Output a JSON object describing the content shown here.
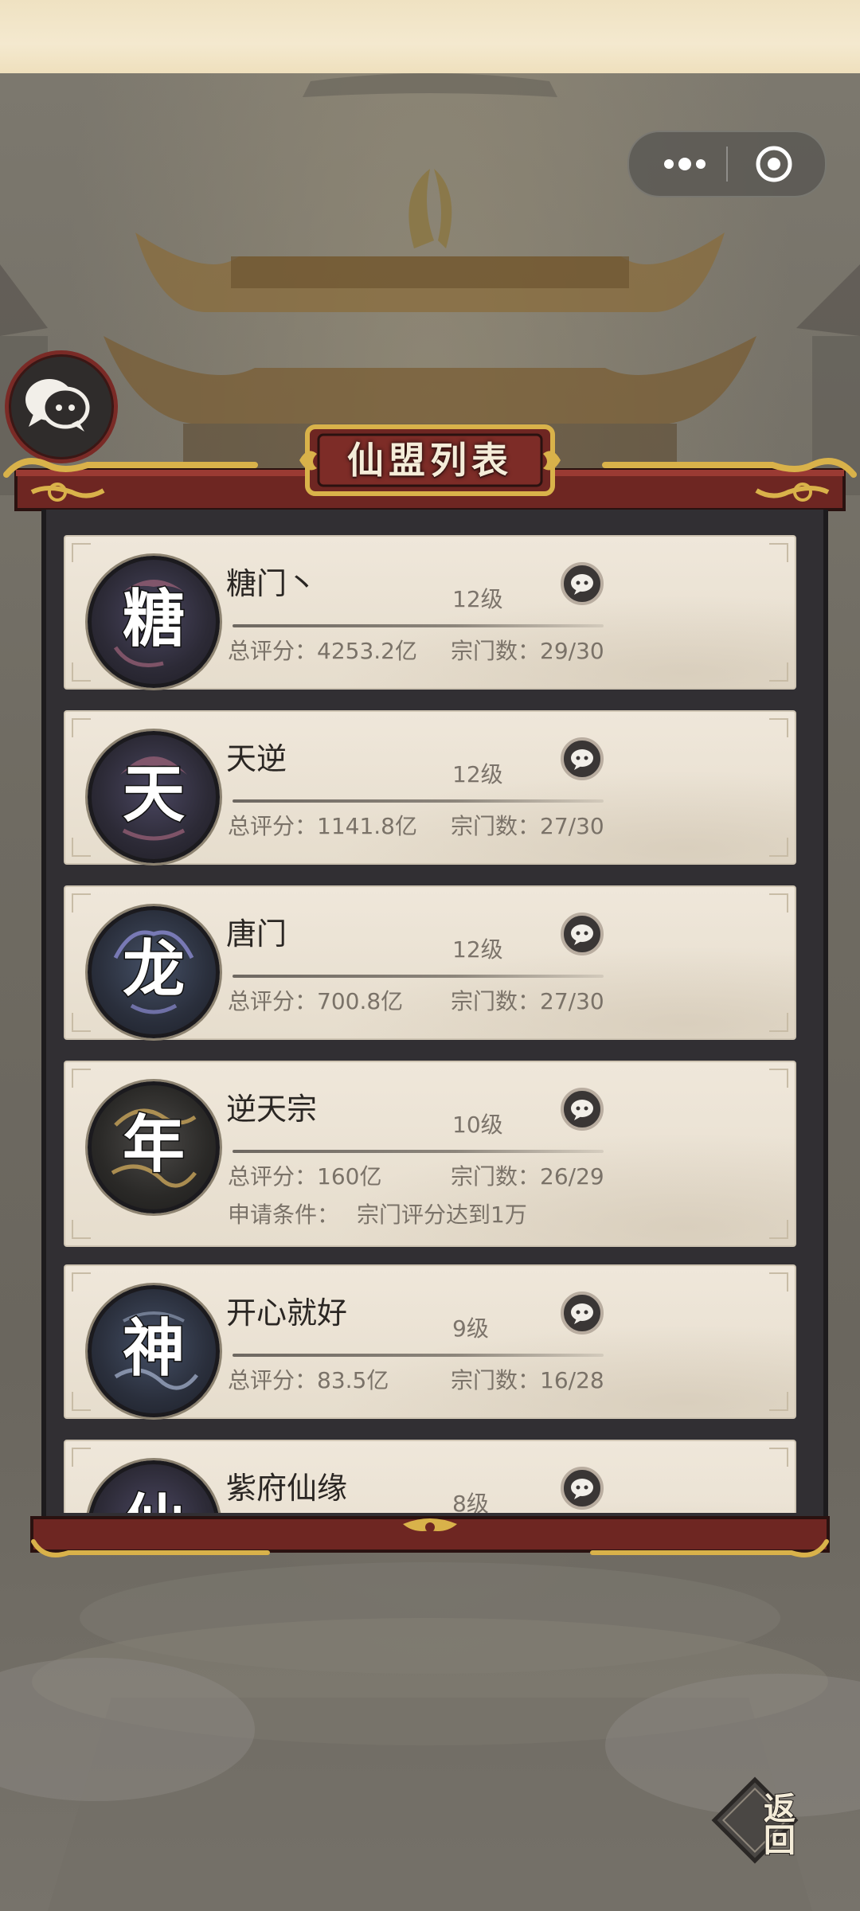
{
  "panel": {
    "title": "仙盟列表"
  },
  "alliances": [
    {
      "emblem_char": "糖",
      "name": "糖门丶",
      "level": "12级",
      "score_label": "总评分：",
      "score": "4253.2亿",
      "members_label": "宗门数：",
      "members": "29/30"
    },
    {
      "emblem_char": "天",
      "name": "天逆",
      "level": "12级",
      "score_label": "总评分：",
      "score": "1141.8亿",
      "members_label": "宗门数：",
      "members": "27/30"
    },
    {
      "emblem_char": "龙",
      "name": "唐门",
      "level": "12级",
      "score_label": "总评分：",
      "score": "700.8亿",
      "members_label": "宗门数：",
      "members": "27/30"
    },
    {
      "emblem_char": "年",
      "name": "逆天宗",
      "level": "10级",
      "score_label": "总评分：",
      "score": "160亿",
      "members_label": "宗门数：",
      "members": "26/29",
      "requirement_label": "申请条件：",
      "requirement": "宗门评分达到1万"
    },
    {
      "emblem_char": "神",
      "name": "开心就好",
      "level": "9级",
      "score_label": "总评分：",
      "score": "83.5亿",
      "members_label": "宗门数：",
      "members": "16/28"
    },
    {
      "emblem_char": "仙",
      "name": "紫府仙缘",
      "level": "8级"
    }
  ],
  "back_button": {
    "label": "返回"
  },
  "colors": {
    "card_bg": "#eae2d4",
    "frame_red": "#7a2a26",
    "gold_trim": "#d9b24a",
    "frame_dark": "#312f33"
  },
  "icons": {
    "more": "more-dots-icon",
    "close": "target-close-icon",
    "chat": "chat-bubble-icon"
  }
}
